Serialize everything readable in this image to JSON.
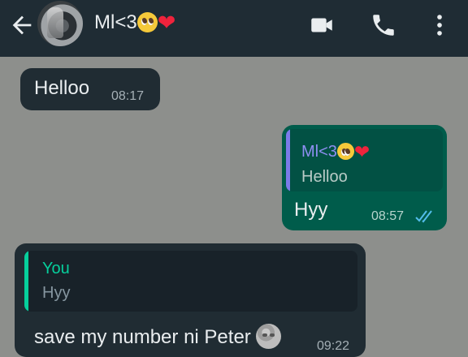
{
  "header": {
    "contact_name": "Ml<3",
    "actions": [
      "video-call-icon",
      "voice-call-icon",
      "more-options-icon"
    ],
    "background": "#1f2c34"
  },
  "messages": [
    {
      "direction": "incoming",
      "text": "Helloo",
      "time": "08:17"
    },
    {
      "direction": "outgoing",
      "quoted_author": "Ml<3",
      "quoted_text": "Helloo",
      "text": "Hyy",
      "time": "08:57",
      "status": "read"
    },
    {
      "direction": "incoming",
      "quoted_author": "You",
      "quoted_text": "Hyy",
      "text": "save my number ni Peter",
      "time": "09:22"
    }
  ],
  "colors": {
    "incoming_bubble": "#202c33",
    "outgoing_bubble": "#005c4b",
    "read_receipt": "#53bdeb",
    "you_accent": "#06cf9c",
    "contact_accent": "#7b7bea"
  }
}
